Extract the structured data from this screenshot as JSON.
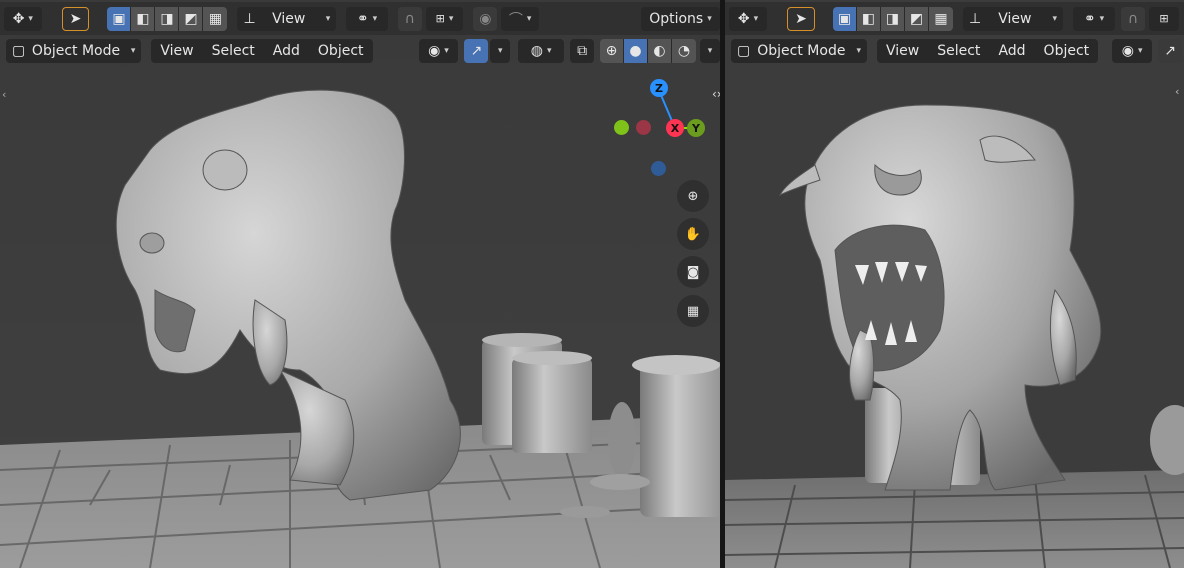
{
  "left_viewport": {
    "editor_type_icon": "viewport-icon",
    "select_tool_icon": "cursor-icon",
    "transform_label": "View",
    "options_label": "Options",
    "mode_label": "Object Mode",
    "menus": [
      "View",
      "Select",
      "Add",
      "Object"
    ],
    "gizmo": {
      "z": "Z",
      "x": "X",
      "y": "Y"
    },
    "nav_icons": [
      "zoom-icon",
      "hand-icon",
      "camera-icon",
      "grid-icon"
    ]
  },
  "right_viewport": {
    "transform_label": "View",
    "mode_label": "Object Mode",
    "menus": [
      "View",
      "Select",
      "Add",
      "Object"
    ]
  },
  "colors": {
    "header_bg": "#303030",
    "viewport_bg": "#3d3d3d",
    "accent_blue": "#4772b3",
    "axis_x": "#ff3352",
    "axis_y": "#8bdc00",
    "axis_z": "#2890ff"
  }
}
